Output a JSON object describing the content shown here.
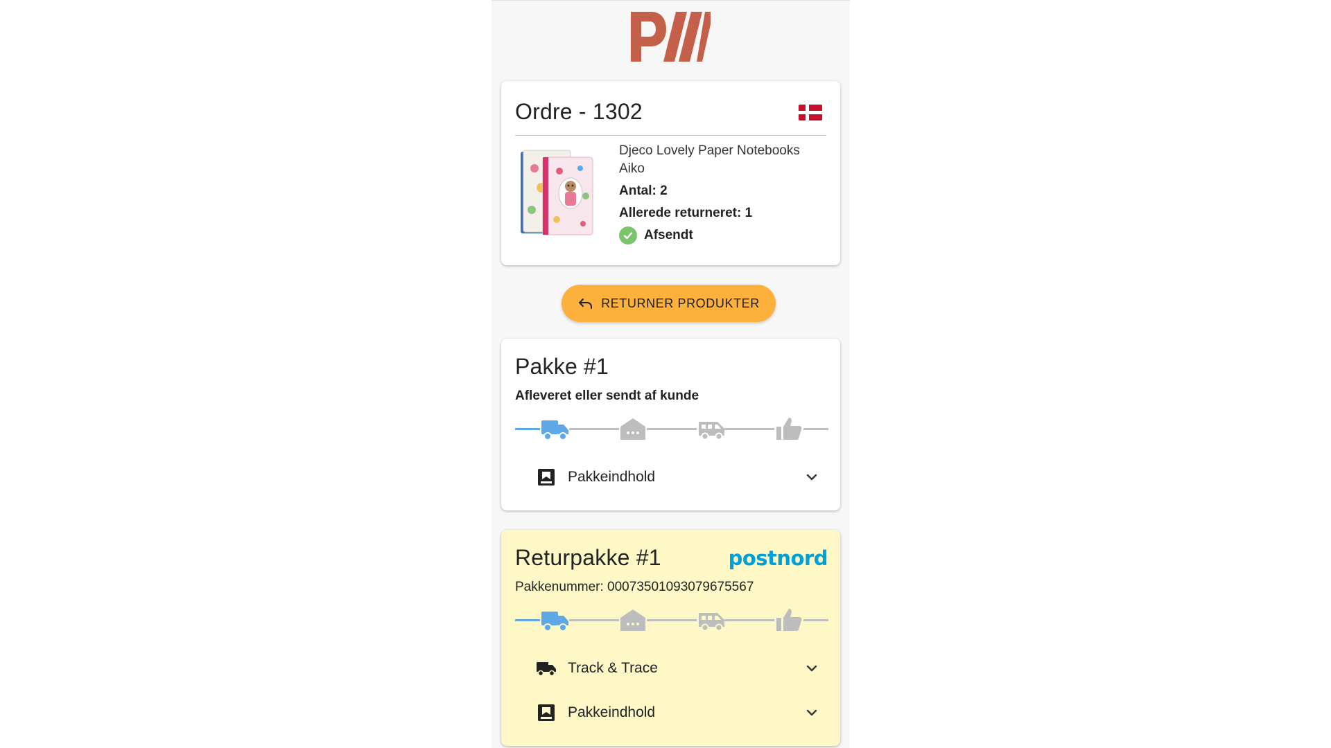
{
  "brand": {
    "logo_text": "PW",
    "logo_color": "#c4604a"
  },
  "order": {
    "title": "Ordre - 1302",
    "country_flag_icon": "denmark-flag-icon",
    "product": {
      "name": "Djeco Lovely Paper Notebooks Aiko",
      "quantity": "Antal: 2",
      "already_returned": "Allerede returneret: 1",
      "status": "Afsendt",
      "status_color": "#7bc46b"
    }
  },
  "return_button": {
    "label": "RETURNER PRODUKTER",
    "icon": "undo-arrow-icon",
    "color": "#fbb13c"
  },
  "package": {
    "title": "Pakke #1",
    "status": "Afleveret eller sendt af kunde",
    "tracker_steps": [
      "delivery-truck-icon",
      "warehouse-icon",
      "van-icon",
      "thumbs-up-icon"
    ],
    "active_step": 1,
    "contents_label": "Pakkeindhold"
  },
  "return_package": {
    "title": "Returpakke #1",
    "carrier": "postnord",
    "carrier_color": "#00a0d6",
    "package_number": "Pakkenummer: 00073501093079675567",
    "tracker_steps": [
      "delivery-truck-icon",
      "warehouse-icon",
      "van-icon",
      "thumbs-up-icon"
    ],
    "active_step": 1,
    "track_label": "Track & Trace",
    "contents_label": "Pakkeindhold",
    "background": "#fdf8c6"
  },
  "colors": {
    "active": "#5fa8e8",
    "inactive": "#bdbdbd"
  }
}
